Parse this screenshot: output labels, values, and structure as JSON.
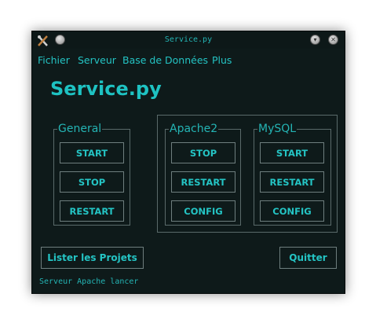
{
  "window": {
    "title": "Service.py",
    "icons": {
      "app": "tools-icon",
      "menu": "circle-menu-icon",
      "minimize": "chevron-down-icon",
      "close": "close-icon"
    }
  },
  "menu": {
    "items": [
      "Fichier",
      "Serveur",
      "Base de Données",
      "Plus"
    ]
  },
  "header": {
    "title": "Service.py"
  },
  "groups": {
    "general": {
      "title": "General",
      "buttons": [
        "START",
        "STOP",
        "RESTART"
      ]
    },
    "apache": {
      "title": "Apache2",
      "buttons": [
        "STOP",
        "RESTART",
        "CONFIG"
      ]
    },
    "mysql": {
      "title": "MySQL",
      "buttons": [
        "START",
        "RESTART",
        "CONFIG"
      ]
    }
  },
  "actions": {
    "list_projects": "Lister les Projets",
    "quit": "Quitter"
  },
  "status": {
    "text": "Serveur Apache lancer"
  },
  "colors": {
    "background": "#0e1a1a",
    "accent": "#24c4c4",
    "border": "#6e7e7e"
  }
}
